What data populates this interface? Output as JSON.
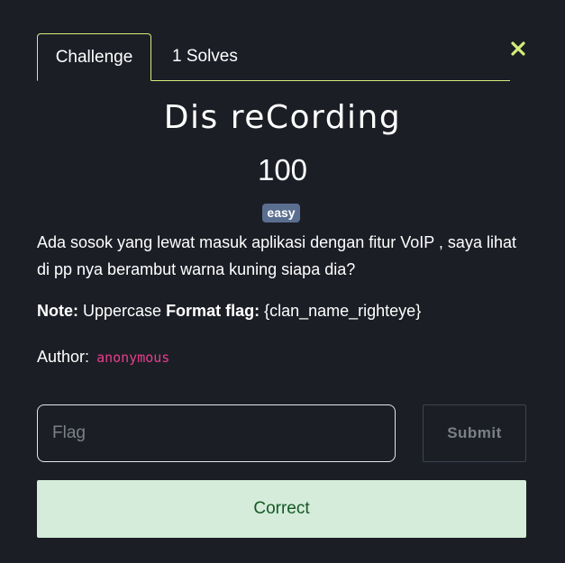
{
  "tabs": [
    {
      "label": "Challenge"
    },
    {
      "label": "1 Solves"
    }
  ],
  "challenge": {
    "title": "Dis reCording",
    "value": "100",
    "difficulty": "easy",
    "description": "Ada sosok yang lewat masuk aplikasi dengan fitur VoIP , saya lihat di pp nya berambut warna kuning siapa dia?",
    "note_label": "Note:",
    "note_text": " Uppercase ",
    "format_label": "Format flag:",
    "format_text": " {clan_name_righteye}",
    "author_label": "Author:",
    "author_name": "anonymous"
  },
  "form": {
    "flag_placeholder": "Flag",
    "submit_label": "Submit",
    "result_message": "Correct"
  },
  "icons": {
    "close": "close-icon"
  },
  "colors": {
    "background": "#1c1e26",
    "accent": "#d6ec7a",
    "badge": "#5a6e8f",
    "author": "#e83e8c",
    "success_bg": "#d4ecd9",
    "success_text": "#155724"
  }
}
